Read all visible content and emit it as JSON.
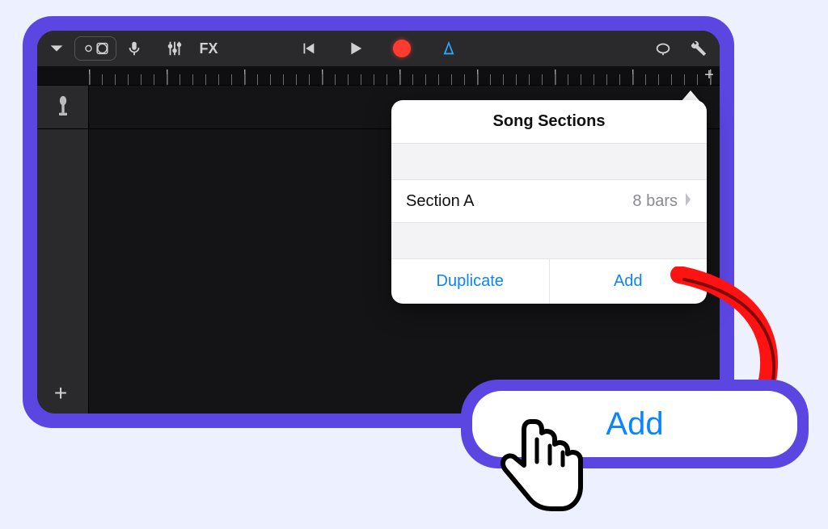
{
  "toolbar": {
    "fx_label": "FX"
  },
  "popover": {
    "title": "Song Sections",
    "section_name": "Section A",
    "section_detail": "8 bars",
    "duplicate_label": "Duplicate",
    "add_label": "Add"
  },
  "callout": {
    "add_label": "Add"
  }
}
